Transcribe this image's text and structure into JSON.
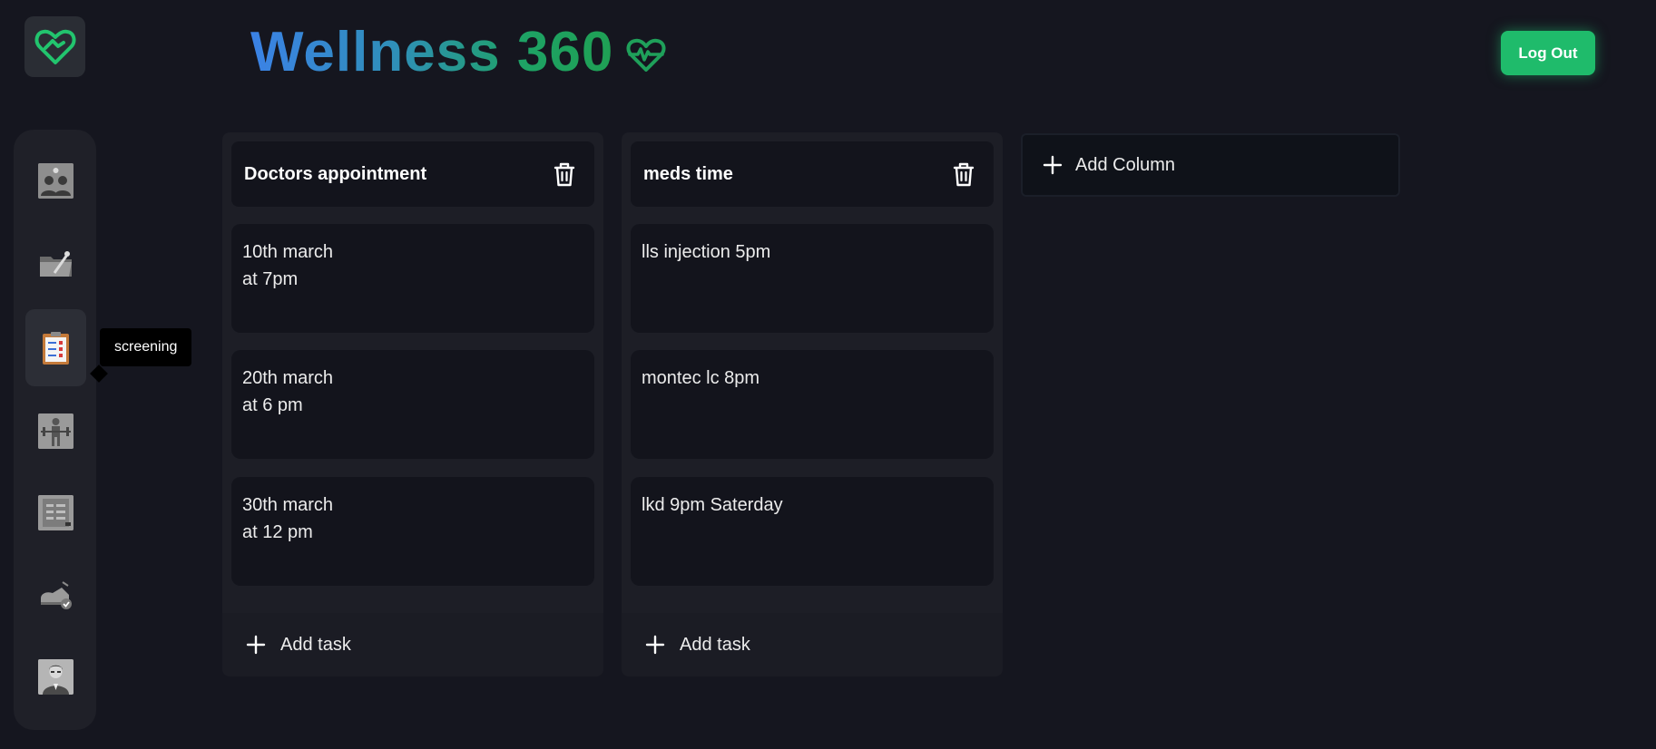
{
  "header": {
    "title": "Wellness 360",
    "logout_label": "Log Out",
    "accent_color": "#1fbb6b"
  },
  "sidebar": {
    "items": [
      {
        "icon": "team-icon"
      },
      {
        "icon": "folder-tools-icon"
      },
      {
        "icon": "clipboard-checklist-icon",
        "active": true
      },
      {
        "icon": "fitness-icon"
      },
      {
        "icon": "document-list-icon"
      },
      {
        "icon": "shoe-icon"
      },
      {
        "icon": "doctor-avatar-icon"
      }
    ],
    "tooltip": "screening"
  },
  "board": {
    "columns": [
      {
        "title": "Doctors appointment",
        "tasks": [
          "10th march\nat 7pm",
          "20th march\nat 6 pm",
          "30th march\nat 12 pm"
        ],
        "add_task_label": "Add task"
      },
      {
        "title": "meds time",
        "tasks": [
          "lls injection 5pm",
          "montec lc 8pm",
          "lkd 9pm Saterday"
        ],
        "add_task_label": "Add task"
      }
    ],
    "add_column_label": "Add Column"
  }
}
